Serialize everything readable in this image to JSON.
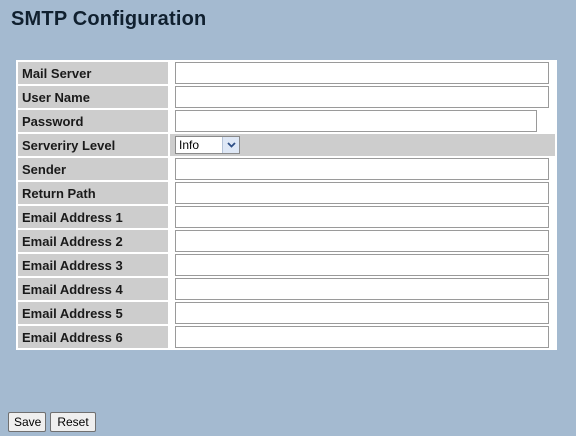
{
  "page": {
    "title": "SMTP Configuration"
  },
  "fields": {
    "mail_server": {
      "label": "Mail Server",
      "value": ""
    },
    "user_name": {
      "label": "User Name",
      "value": ""
    },
    "password": {
      "label": "Password",
      "value": ""
    },
    "severity_level": {
      "label": "Serveriry Level",
      "selected": "Info"
    },
    "sender": {
      "label": "Sender",
      "value": ""
    },
    "return_path": {
      "label": "Return Path",
      "value": ""
    },
    "email_address_1": {
      "label": "Email Address 1",
      "value": ""
    },
    "email_address_2": {
      "label": "Email Address 2",
      "value": ""
    },
    "email_address_3": {
      "label": "Email Address 3",
      "value": ""
    },
    "email_address_4": {
      "label": "Email Address 4",
      "value": ""
    },
    "email_address_5": {
      "label": "Email Address 5",
      "value": ""
    },
    "email_address_6": {
      "label": "Email Address 6",
      "value": ""
    }
  },
  "buttons": {
    "save_label": "Save",
    "reset_label": "Reset"
  },
  "colors": {
    "page_background": "#a4bad0",
    "label_cell": "#cdcdcd",
    "title_text": "#10202f"
  },
  "icons": {
    "severity_dropdown": "chevron-down-icon"
  }
}
